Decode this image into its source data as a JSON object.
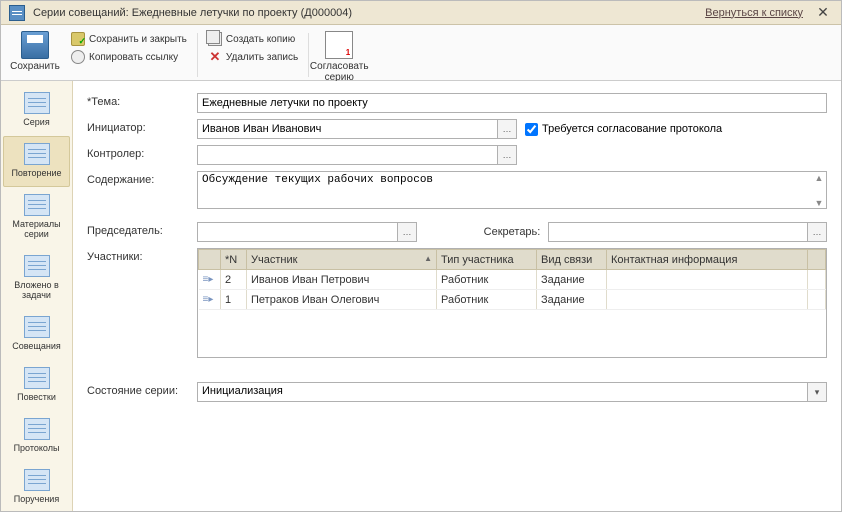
{
  "titlebar": {
    "title": "Серии совещаний: Ежедневные летучки по проекту (Д000004)",
    "back_link": "Вернуться к списку"
  },
  "toolbar": {
    "save": "Сохранить",
    "save_close": "Сохранить и закрыть",
    "copy_link": "Копировать ссылку",
    "create_copy": "Создать копию",
    "delete_rec": "Удалить запись",
    "approve_series": "Согласовать серию"
  },
  "sidebar": [
    {
      "key": "series",
      "label": "Серия"
    },
    {
      "key": "repeat",
      "label": "Повторение"
    },
    {
      "key": "materials",
      "label": "Материалы серии"
    },
    {
      "key": "tasks",
      "label": "Вложено в задачи"
    },
    {
      "key": "meetings",
      "label": "Совещания"
    },
    {
      "key": "agendas",
      "label": "Повестки"
    },
    {
      "key": "protocols",
      "label": "Протоколы"
    },
    {
      "key": "orders",
      "label": "Поручения"
    }
  ],
  "form": {
    "labels": {
      "topic": "*Тема:",
      "initiator": "Инициатор:",
      "controller": "Контролер:",
      "content": "Содержание:",
      "chairman": "Председатель:",
      "secretary": "Секретарь:",
      "participants": "Участники:",
      "status": "Состояние серии:"
    },
    "topic": "Ежедневные летучки по проекту",
    "initiator": "Иванов Иван Иванович",
    "controller": "",
    "content": "Обсуждение текущих рабочих вопросов",
    "chairman": "",
    "secretary": "",
    "approval_checkbox": "Требуется согласование протокола",
    "approval_checked": true,
    "status": "Инициализация"
  },
  "table": {
    "columns": {
      "num": "*N",
      "participant": "Участник",
      "type": "Тип участника",
      "link": "Вид связи",
      "contact": "Контактная информация"
    },
    "rows": [
      {
        "n": "2",
        "participant": "Иванов Иван Петрович",
        "type": "Работник",
        "link": "Задание",
        "contact": ""
      },
      {
        "n": "1",
        "participant": "Петраков Иван Олегович",
        "type": "Работник",
        "link": "Задание",
        "contact": ""
      }
    ]
  }
}
